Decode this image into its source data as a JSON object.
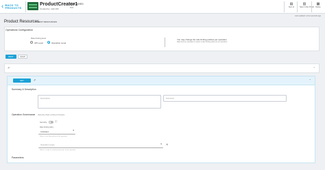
{
  "header": {
    "back_label": "BACK TO PRODUCTS",
    "product_title": "ProductCreator1",
    "product_subtitle": "Created by: adminfifi",
    "status": "PUBLISHED",
    "owner": "Dsb",
    "buttons": [
      {
        "label": "Sync to",
        "icon": "sync-icon"
      },
      {
        "label": "Save in Dev Portal",
        "icon": "doc-icon"
      },
      {
        "label": "Delete",
        "icon": "trash-icon"
      }
    ],
    "last_updated": "Last updated: a few seconds ago"
  },
  "resources": {
    "title": "Product Resources",
    "edit_label": "EDIT RESOURCES"
  },
  "operation_config": {
    "title": "Operations Configuration",
    "rate_limit_label": "Rate limiting level",
    "options": [
      "API Level",
      "Operation Level"
    ],
    "selected": "Operation Level",
    "info_text": "You may change the rate limiting policies per operation",
    "info_sub": "Rate limit per operation to select a rate limiting policy for an operation"
  },
  "toggle": {
    "active": "REST",
    "inactive": "SOAP"
  },
  "resource": {
    "method": "GET",
    "summary_section": "Summary & Description",
    "description_placeholder": "Description",
    "summary_placeholder": "Summary",
    "governance_section": "Operation Governance",
    "governance_hint": "(Security, Rate Limiting & Scopes)",
    "security_label": "Security",
    "rate_limit_label": "Rate limiting policy",
    "rate_limit_value": "Unlimited",
    "rate_limit_hint": "Select a rate limit policy for this operation",
    "scope_placeholder": "Operation scope",
    "scope_hint": "Select a scope to control permissions to this operation",
    "parameters_section": "Parameters"
  },
  "colors": {
    "accent": "#1aa1d6",
    "brand": "#1f6d3c"
  }
}
